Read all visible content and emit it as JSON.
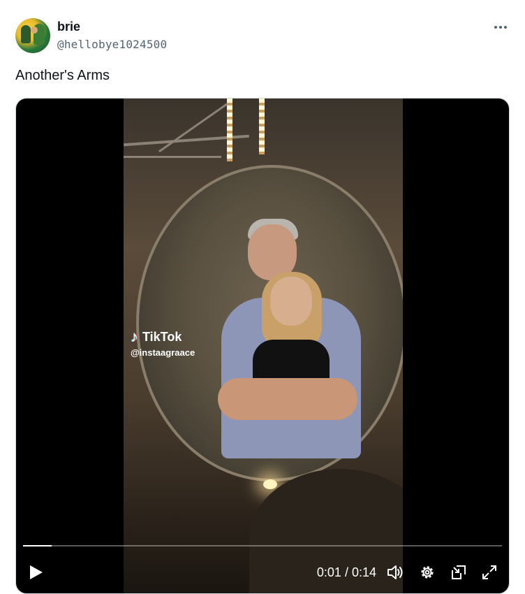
{
  "tweet": {
    "author_name": "brie",
    "author_handle": "@hellobye1024500",
    "text": "Another's Arms"
  },
  "video": {
    "watermark_brand": "TikTok",
    "watermark_user": "@instaagraace",
    "current_time": "0:01",
    "separator": " / ",
    "duration": "0:14",
    "progress": 0.06
  },
  "icons": {
    "more": "more-horizontal-icon",
    "play": "play-icon",
    "volume": "volume-icon",
    "settings": "gear-icon",
    "pip": "picture-in-picture-icon",
    "fullscreen": "fullscreen-icon"
  }
}
